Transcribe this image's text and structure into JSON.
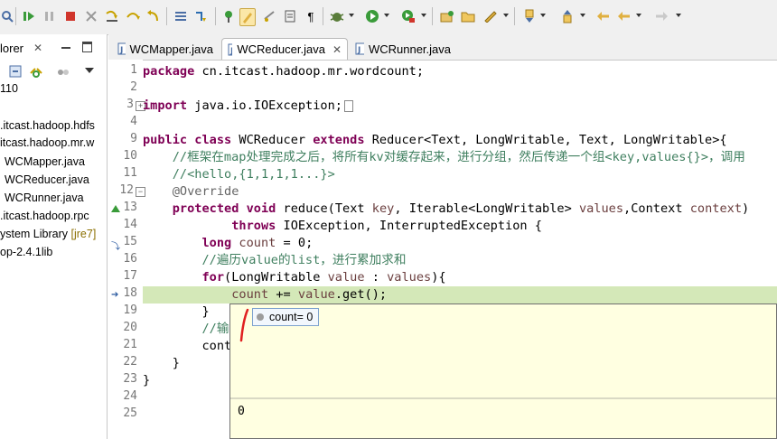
{
  "explorer": {
    "tab_label": "lorer",
    "lines": [
      {
        "text": "110",
        "kind": "plain"
      },
      {
        "text": ".itcast.hadoop.hdfs",
        "kind": "pkg"
      },
      {
        "text": "itcast.hadoop.mr.w",
        "kind": "pkg"
      },
      {
        "text": "WCMapper.java",
        "kind": "file"
      },
      {
        "text": "WCReducer.java",
        "kind": "file"
      },
      {
        "text": "WCRunner.java",
        "kind": "file"
      },
      {
        "text": ".itcast.hadoop.rpc",
        "kind": "pkg"
      },
      {
        "text": "ystem Library",
        "kind": "lib",
        "extra": "[jre7]"
      },
      {
        "text": "op-2.4.1lib",
        "kind": "lib"
      }
    ]
  },
  "editor": {
    "tabs": [
      {
        "label": "WCMapper.java",
        "active": false
      },
      {
        "label": "WCReducer.java",
        "active": true,
        "close": "✕"
      },
      {
        "label": "WCRunner.java",
        "active": false
      }
    ],
    "line_numbers": [
      "1",
      "2",
      "3",
      "4",
      "5",
      "9",
      "10",
      "11",
      "12",
      "13",
      "14",
      "15",
      "16",
      "17",
      "18",
      "19",
      "20",
      "21",
      "22",
      "23",
      "24",
      "25"
    ],
    "code": {
      "l1a": "package",
      "l1b": " cn.itcast.hadoop.mr.wordcount;",
      "l3a": "import",
      "l3b": " java.io.IOException;",
      "l9a": "public",
      "l9b": " ",
      "l9c": "class",
      "l9d": " WCReducer ",
      "l9e": "extends",
      "l9f": " Reducer<Text, LongWritable, Text, LongWritable>{",
      "l10": "    //框架在map处理完成之后，将所有kv对缓存起来，进行分组，然后传递一个组<key,values{}>，调用",
      "l11": "    //<hello,{1,1,1,1...}>",
      "l12": "    @Override",
      "l13a": "    ",
      "l13b": "protected",
      "l13c": " ",
      "l13d": "void",
      "l13e": " reduce(Text ",
      "l13f": "key",
      "l13g": ", Iterable<LongWritable> ",
      "l13h": "values",
      "l13i": ",Context ",
      "l13j": "context",
      "l13k": ")",
      "l14a": "            ",
      "l14b": "throws",
      "l14c": " IOException, InterruptedException {",
      "l15a": "        ",
      "l15b": "long",
      "l15c": " ",
      "l15d": "count",
      "l15e": " = 0;",
      "l16": "        //遍历value的list，进行累加求和",
      "l17a": "        ",
      "l17b": "for",
      "l17c": "(LongWritable ",
      "l17d": "value",
      "l17e": " : ",
      "l17f": "values",
      "l17g": "){",
      "l18a": "            ",
      "l18b": "count",
      "l18c": " += ",
      "l18d": "value",
      "l18e": ".get();",
      "l19": "        }",
      "l20": "        //输",
      "l21": "        cont",
      "l22": "    }",
      "l23": "}"
    }
  },
  "popup": {
    "variable": "count= 0",
    "detail": "0"
  },
  "colors": {
    "keyword": "#7f0055",
    "comment": "#3f7f5f",
    "field": "#0000c0",
    "highlight": "#d4e8b8",
    "popup_bg": "#ffffe1"
  }
}
